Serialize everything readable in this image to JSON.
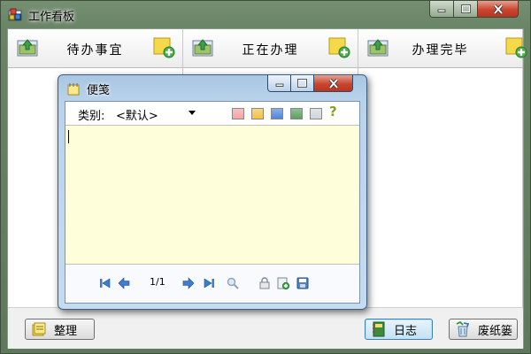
{
  "window": {
    "title": "工作看板"
  },
  "columns": [
    {
      "label": "待办事宜"
    },
    {
      "label": "正在办理"
    },
    {
      "label": "办理完毕"
    }
  ],
  "footer": {
    "organize_label": "整理",
    "log_label": "日志",
    "trash_label": "废纸篓"
  },
  "note": {
    "title": "便笺",
    "category_label": "类别:",
    "category_value": "<默认>",
    "colors": [
      "#f4a3a8",
      "#f3c247",
      "#4f86dc",
      "#5aa05e",
      "#cfd6de"
    ],
    "help_symbol": "?",
    "content": "",
    "page_indicator": "1/1"
  },
  "accent_colors": {
    "titlebar": "#6a8467",
    "close": "#c9452e",
    "note_bg": "#fffedb"
  }
}
